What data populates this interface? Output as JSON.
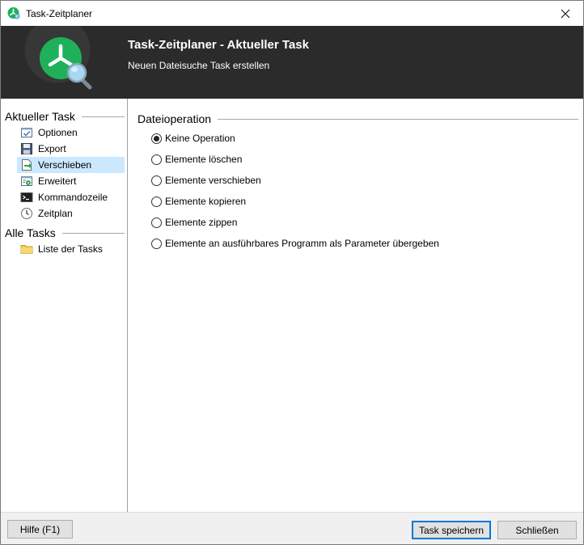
{
  "window": {
    "title": "Task-Zeitplaner"
  },
  "banner": {
    "heading": "Task-Zeitplaner - Aktueller Task",
    "subheading": "Neuen Dateisuche Task erstellen"
  },
  "sidebar": {
    "section_current": "Aktueller Task",
    "current_items": [
      {
        "label": "Optionen",
        "icon": "checklist-icon"
      },
      {
        "label": "Export",
        "icon": "floppy-disk-icon"
      },
      {
        "label": "Verschieben",
        "icon": "move-arrow-icon",
        "selected": true
      },
      {
        "label": "Erweitert",
        "icon": "advanced-settings-icon"
      },
      {
        "label": "Kommandozeile",
        "icon": "command-line-icon"
      },
      {
        "label": "Zeitplan",
        "icon": "clock-icon"
      }
    ],
    "section_all": "Alle Tasks",
    "all_items": [
      {
        "label": "Liste der Tasks",
        "icon": "folder-icon"
      }
    ]
  },
  "main": {
    "group_title": "Dateioperation",
    "options": [
      {
        "label": "Keine Operation",
        "checked": true
      },
      {
        "label": "Elemente löschen",
        "checked": false
      },
      {
        "label": "Elemente verschieben",
        "checked": false
      },
      {
        "label": "Elemente kopieren",
        "checked": false
      },
      {
        "label": "Elemente zippen",
        "checked": false
      },
      {
        "label": "Elemente an ausführbares Programm als Parameter übergeben",
        "checked": false
      }
    ]
  },
  "footer": {
    "help_label": "Hilfe (F1)",
    "save_label": "Task speichern",
    "close_label": "Schließen"
  },
  "colors": {
    "banner_bg": "#2b2b2b",
    "logo_green": "#1fb15a",
    "selection": "#cce8ff",
    "accent_blue": "#0078d7"
  }
}
